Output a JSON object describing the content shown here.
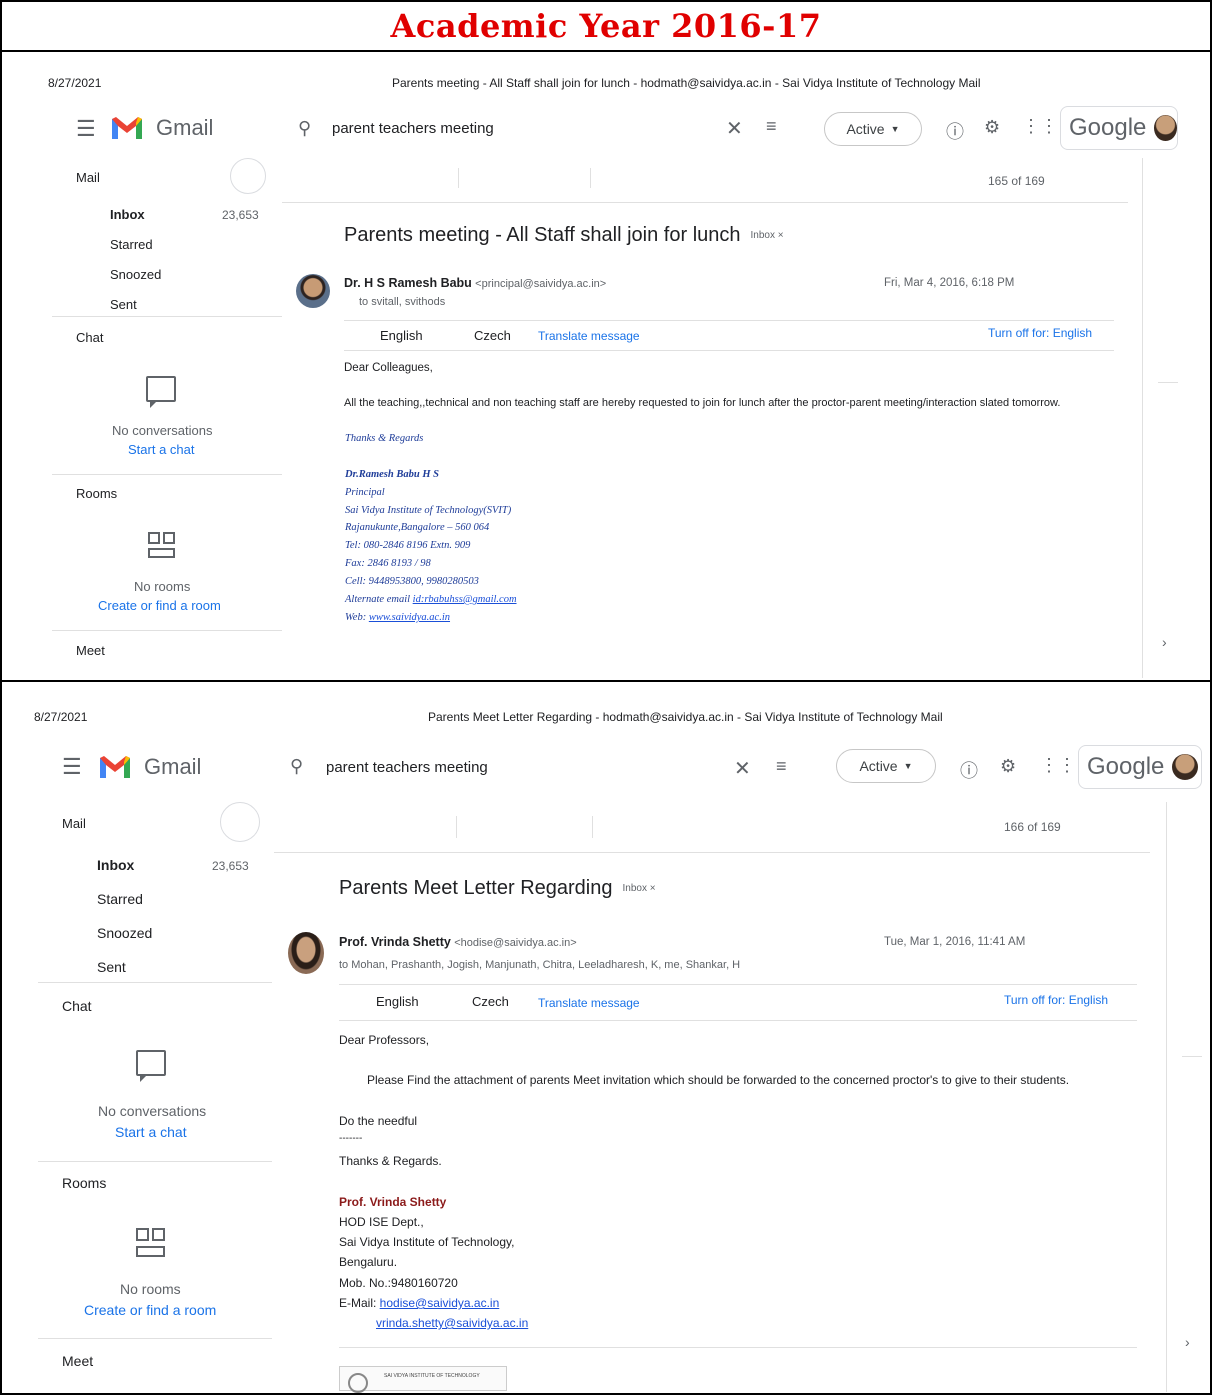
{
  "header": {
    "title": "Academic Year 2016-17"
  },
  "colors": {
    "title_red": "#e00000",
    "gmail_red": "#ea4335",
    "link_blue": "#1a73e8",
    "sig_blue": "#1f3d99",
    "sig_red": "#8b1a1a"
  },
  "shot1": {
    "print_date": "8/27/2021",
    "print_title": "Parents meeting - All Staff shall join for lunch - hodmath@saividya.ac.in - Sai Vidya Institute of Technology Mail",
    "app_name": "Gmail",
    "search_query": "parent teachers meeting",
    "status": "Active",
    "google_label": "Google",
    "sidebar": {
      "mail_label": "Mail",
      "inbox_label": "Inbox",
      "inbox_count": "23,653",
      "starred_label": "Starred",
      "snoozed_label": "Snoozed",
      "sent_label": "Sent",
      "chat_label": "Chat",
      "no_conversations": "No conversations",
      "start_chat": "Start a chat",
      "rooms_label": "Rooms",
      "no_rooms": "No rooms",
      "create_room": "Create or find a room",
      "meet_label": "Meet"
    },
    "counter": "165 of 169",
    "subject": "Parents meeting - All Staff shall join for lunch",
    "inbox_badge": "Inbox ×",
    "sender_name": "Dr. H S Ramesh Babu",
    "sender_email": "<principal@saividya.ac.in>",
    "recipients": "to svitall, svithods",
    "date": "Fri, Mar 4, 2016, 6:18 PM",
    "lang_from": "English",
    "lang_to": "Czech",
    "translate": "Translate message",
    "turn_off": "Turn off for: English",
    "greeting": "Dear Colleagues,",
    "body": "All the teaching,,technical and non teaching staff are hereby requested to join for lunch after the proctor-parent meeting/interaction slated tomorrow.",
    "signature": {
      "regards": "Thanks & Regards",
      "name": "Dr.Ramesh Babu H S",
      "role": "Principal",
      "org": "Sai Vidya Institute of Technology(SVIT)",
      "addr": "Rajanukunte,Bangalore – 560 064",
      "tel": "Tel: 080-2846 8196 Extn. 909",
      "fax": "Fax: 2846 8193 / 98",
      "cell": "Cell: 9448953800, 9980280503",
      "alt_email_label": "Alternate email ",
      "alt_email": "id:rbabuhss@gmail.com",
      "web_label": "Web: ",
      "web": "www.saividya.ac.in"
    }
  },
  "shot2": {
    "print_date": "8/27/2021",
    "print_title": "Parents Meet Letter Regarding - hodmath@saividya.ac.in - Sai Vidya Institute of Technology Mail",
    "app_name": "Gmail",
    "search_query": "parent teachers meeting",
    "status": "Active",
    "google_label": "Google",
    "sidebar": {
      "mail_label": "Mail",
      "inbox_label": "Inbox",
      "inbox_count": "23,653",
      "starred_label": "Starred",
      "snoozed_label": "Snoozed",
      "sent_label": "Sent",
      "chat_label": "Chat",
      "no_conversations": "No conversations",
      "start_chat": "Start a chat",
      "rooms_label": "Rooms",
      "no_rooms": "No rooms",
      "create_room": "Create or find a room",
      "meet_label": "Meet"
    },
    "counter": "166 of 169",
    "subject": "Parents Meet Letter Regarding",
    "inbox_badge": "Inbox ×",
    "sender_name": "Prof. Vrinda Shetty",
    "sender_email": "<hodise@saividya.ac.in>",
    "recipients": "to Mohan, Prashanth, Jogish, Manjunath, Chitra, Leeladharesh, K, me, Shankar, H",
    "date": "Tue, Mar 1, 2016, 11:41 AM",
    "lang_from": "English",
    "lang_to": "Czech",
    "translate": "Translate message",
    "turn_off": "Turn off for: English",
    "greeting": "Dear Professors,",
    "body": "Please Find the attachment of parents Meet invitation which should be forwarded to the concerned proctor's to give to their students.",
    "needful": "Do the needful",
    "dashes": "-------",
    "regards": "Thanks & Regards.",
    "signature": {
      "name": "Prof. Vrinda Shetty",
      "dept": "HOD ISE Dept.,",
      "org": "Sai Vidya Institute of Technology,",
      "city": "Bengaluru.",
      "mob": "Mob. No.:9480160720",
      "email_label": "E-Mail: ",
      "email1": "hodise@saividya.ac.in",
      "email2": "vrinda.shetty@saividya.ac.in"
    },
    "attachment_label": "SAI VIDYA INSTITUTE OF TECHNOLOGY"
  }
}
